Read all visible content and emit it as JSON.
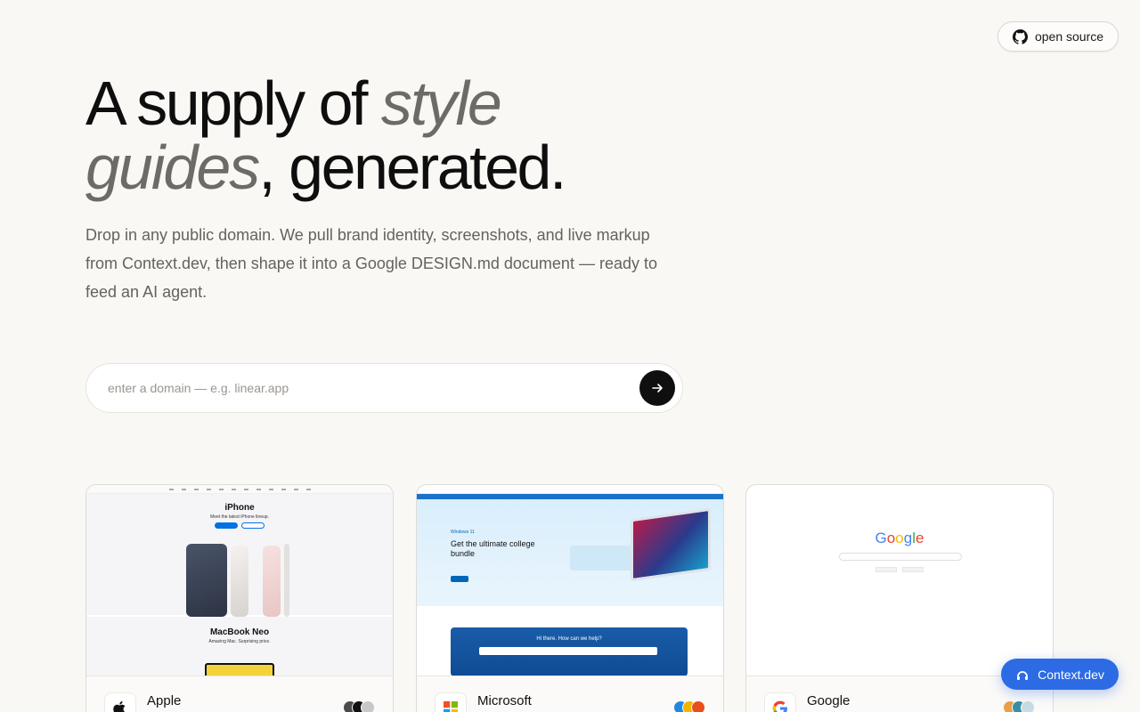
{
  "header": {
    "oss_label": "open source"
  },
  "hero": {
    "title_part1": "A supply of ",
    "title_italic1": "style",
    "title_italic2": "guides",
    "title_part2": ", generated.",
    "description": "Drop in any public domain. We pull brand identity, screenshots, and live markup from Context.dev, then shape it into a Google DESIGN.md document — ready to feed an AI agent."
  },
  "search": {
    "placeholder": "enter a domain — e.g. linear.app"
  },
  "cards": [
    {
      "name": "Apple",
      "swatches": [
        "#4a4a4a",
        "#111111",
        "#c8c8c8"
      ],
      "preview": {
        "hero_title": "iPhone",
        "hero_sub": "Meet the latest iPhone lineup.",
        "second_title": "MacBook Neo",
        "second_sub": "Amazing Mac. Surprising price."
      }
    },
    {
      "name": "Microsoft",
      "swatches": [
        "#1e88e5",
        "#f4b400",
        "#e94f1d"
      ],
      "preview": {
        "tag": "Windows 11",
        "headline": "Get the ultimate college bundle",
        "help": "Hi there. How can we help?"
      }
    },
    {
      "name": "Google",
      "swatches": [
        "#e8a04a",
        "#3a8ea6",
        "#c9dbe6"
      ],
      "preview": {
        "wordmark": "Google"
      }
    }
  ],
  "badge": {
    "label": "Context.dev"
  },
  "colors": {
    "background": "#f9f8f5",
    "badge": "#2d6be4",
    "ink": "#0e0e0e",
    "muted": "#6e6b66"
  }
}
